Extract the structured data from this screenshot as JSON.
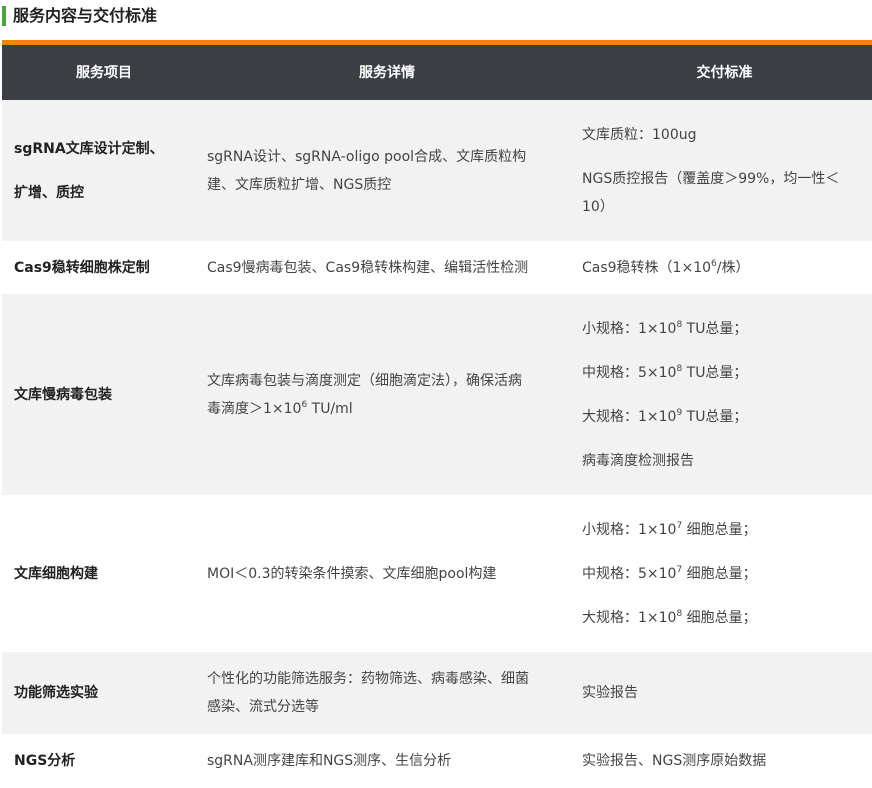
{
  "section_title": "服务内容与交付标准",
  "table": {
    "headers": [
      "服务项目",
      "服务详情",
      "交付标准"
    ],
    "rows": [
      {
        "item": [
          "sgRNA文库设计定制、",
          "扩增、质控"
        ],
        "detail": [
          "sgRNA设计、sgRNA-oligo pool合成、文库质粒构",
          "建、文库质粒扩增、NGS质控"
        ],
        "standard": [
          "文库质粒：100ug",
          "NGS质控报告（覆盖度＞99%，均一性＜",
          "10）"
        ]
      },
      {
        "item": [
          "Cas9稳转细胞株定制"
        ],
        "detail": [
          "Cas9慢病毒包装、Cas9稳转株构建、编辑活性检测"
        ],
        "standard": [
          "Cas9稳转株（1×10",
          "6",
          "/株）"
        ]
      },
      {
        "item": [
          "文库慢病毒包装"
        ],
        "detail": [
          "文库病毒包装与滴度测定（细胞滴定法），确保活病",
          "毒滴度＞1×10",
          "6",
          " TU/ml"
        ],
        "standard": [
          "小规格：1×10",
          "8",
          " TU总量；",
          "中规格：5×10",
          "8",
          " TU总量；",
          "大规格：1×10",
          "9",
          " TU总量；",
          "病毒滴度检测报告"
        ]
      },
      {
        "item": [
          "文库细胞构建"
        ],
        "detail": [
          "MOI＜0.3的转染条件摸索、文库细胞pool构建"
        ],
        "standard": [
          "小规格：1×10",
          "7",
          " 细胞总量；",
          "中规格：5×10",
          "7",
          " 细胞总量；",
          "大规格：1×10",
          "8",
          " 细胞总量；"
        ]
      },
      {
        "item": [
          "功能筛选实验"
        ],
        "detail": [
          "个性化的功能筛选服务：药物筛选、病毒感染、细菌",
          "感染、流式分选等"
        ],
        "standard": [
          "实验报告"
        ]
      },
      {
        "item": [
          "NGS分析"
        ],
        "detail": [
          "sgRNA测序建库和NGS测序、生信分析"
        ],
        "standard": [
          "实验报告、NGS测序原始数据"
        ]
      }
    ]
  },
  "colors": {
    "accent_green": "#4aa53a",
    "accent_orange": "#f0820f",
    "header_bg": "#3b3e43",
    "row_shade": "#f2f2f2"
  }
}
